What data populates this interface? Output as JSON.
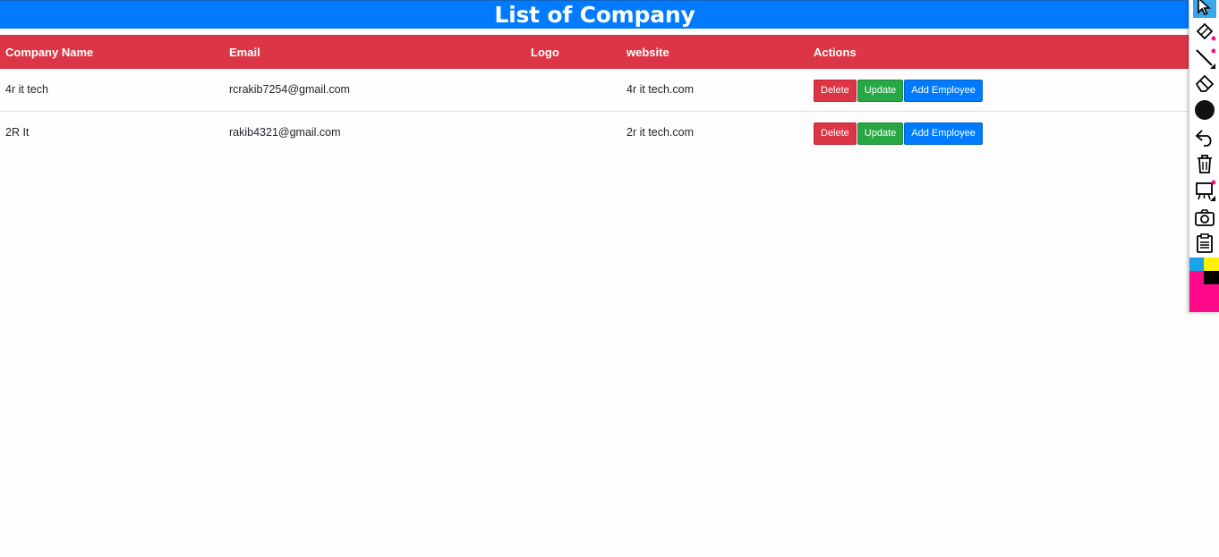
{
  "header": {
    "title": "List of Company"
  },
  "table": {
    "columns": [
      "Company Name",
      "Email",
      "Logo",
      "website",
      "Actions"
    ],
    "rows": [
      {
        "name": "4r it tech",
        "email": "rcrakib7254@gmail.com",
        "logo": "",
        "website": "4r it tech.com"
      },
      {
        "name": "2R It",
        "email": "rakib4321@gmail.com",
        "logo": "",
        "website": "2r it tech.com"
      }
    ],
    "actions": {
      "delete": "Delete",
      "update": "Update",
      "add_employee": "Add Employee"
    }
  },
  "toolbar": {
    "tools": [
      "cursor-icon",
      "pen-icon",
      "line-icon",
      "eraser-icon",
      "brush-size-icon",
      "undo-icon",
      "trash-icon",
      "whiteboard-icon",
      "camera-icon",
      "clipboard-icon"
    ],
    "colors": {
      "cyan": "#1aa3e8",
      "yellow": "#fff200",
      "magenta": "#ff0a8a",
      "black": "#000000"
    }
  },
  "colors": {
    "header_bg": "#007bff",
    "table_header_bg": "#dc3545",
    "danger": "#dc3545",
    "success": "#28a745",
    "primary": "#007bff"
  }
}
